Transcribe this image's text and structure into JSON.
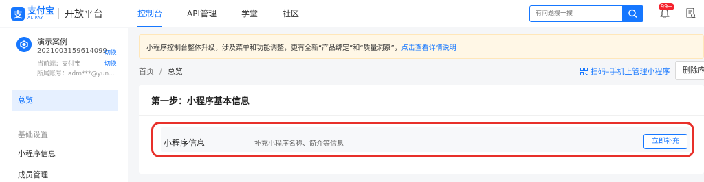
{
  "header": {
    "logo_glyph": "支",
    "logo_cn": "支付宝",
    "logo_en": "ALIPAY",
    "platform": "开放平台",
    "nav": [
      {
        "label": "控制台",
        "active": true
      },
      {
        "label": "API管理",
        "active": false
      },
      {
        "label": "学堂",
        "active": false
      },
      {
        "label": "社区",
        "active": false
      }
    ],
    "search_placeholder": "有问题搜一搜",
    "notification_badge": "99+",
    "accent_color": "#1677ff"
  },
  "sidebar": {
    "app_name": "演示案例",
    "app_id": "2021003159614099",
    "switch_label": "切换",
    "current_end_label": "当前端：支付宝",
    "account_label": "所属账号：adm***@yun...",
    "items": [
      {
        "label": "总览",
        "active": true
      },
      {
        "label": "基础设置",
        "group": true
      },
      {
        "label": "小程序信息",
        "active": false
      },
      {
        "label": "成员管理",
        "active": false
      }
    ]
  },
  "notice": {
    "text": "小程序控制台整体升级，涉及菜单和功能调整，更有全新“产品绑定”和“质量洞察”，",
    "link": "点击查看详情说明"
  },
  "breadcrumb": {
    "home": "首页",
    "separator": "/",
    "current": "总览"
  },
  "actions": {
    "qr_label": "扫码–手机上管理小程序",
    "delete_label": "删除应用"
  },
  "step_card": {
    "title": "第一步：小程序基本信息",
    "row_label": "小程序信息",
    "row_desc": "补充小程序名称、简介等信息",
    "button_label": "立即补充",
    "highlight_color": "#e8302a"
  }
}
